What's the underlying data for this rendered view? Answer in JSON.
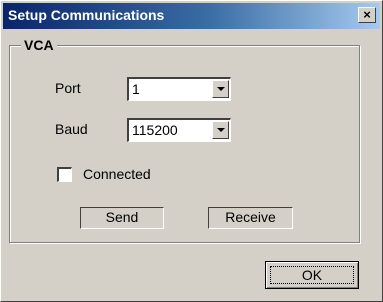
{
  "window": {
    "title": "Setup Communications",
    "close_label": "×"
  },
  "group": {
    "label": "VCA"
  },
  "port": {
    "label": "Port",
    "value": "1"
  },
  "baud": {
    "label": "Baud",
    "value": "115200"
  },
  "connected": {
    "label": "Connected",
    "checked": false
  },
  "buttons": {
    "send": "Send",
    "receive": "Receive",
    "ok": "OK"
  }
}
